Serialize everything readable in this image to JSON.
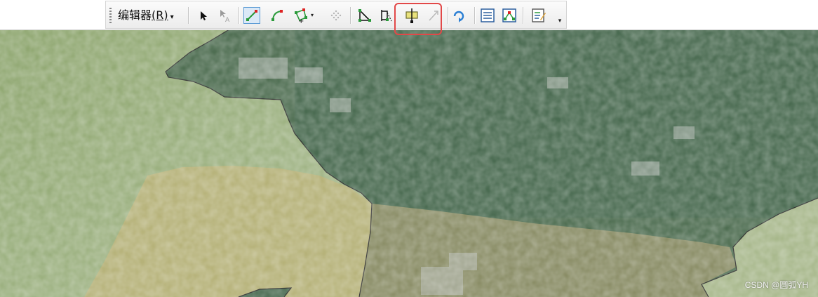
{
  "toolbar": {
    "editor_menu_label": "编辑器",
    "editor_menu_accel": "(R)",
    "dropdown_glyph": "▾",
    "overflow_glyph": "▾",
    "tools": [
      {
        "id": "edit-tool",
        "icon": "cursor-arrow-icon",
        "enabled": true
      },
      {
        "id": "edit-annotation-tool",
        "icon": "annotation-arrow-icon",
        "enabled": false
      },
      {
        "id": "straight-segment",
        "icon": "straight-segment-icon",
        "enabled": true,
        "active": true
      },
      {
        "id": "arc-segment",
        "icon": "arc-segment-icon",
        "enabled": true
      },
      {
        "id": "point-construction",
        "icon": "polygon-point-icon",
        "enabled": true,
        "has_dropdown": true
      },
      {
        "id": "trace",
        "icon": "dotted-trace-icon",
        "enabled": false
      },
      {
        "id": "edit-vertices",
        "icon": "edit-vertices-icon",
        "enabled": true
      },
      {
        "id": "reshape-feature",
        "icon": "reshape-icon",
        "enabled": true
      },
      {
        "id": "cut-polygons",
        "icon": "cut-polygons-icon",
        "enabled": true,
        "highlighted": true
      },
      {
        "id": "split-tool",
        "icon": "split-arrow-icon",
        "enabled": false
      },
      {
        "id": "rotate",
        "icon": "rotate-icon",
        "enabled": true
      },
      {
        "id": "attributes",
        "icon": "attributes-table-icon",
        "enabled": true
      },
      {
        "id": "sketch-properties",
        "icon": "sketch-properties-icon",
        "enabled": true
      },
      {
        "id": "create-features",
        "icon": "create-features-icon",
        "enabled": true
      }
    ]
  },
  "colors": {
    "highlight_border": "#e24848",
    "imagery_green": "#4f6e52",
    "farmland_olive": "#b6b279",
    "light_green": "#9fb486",
    "boundary_line": "#2a2a2a"
  },
  "watermark": "CSDN @圆弧YH"
}
